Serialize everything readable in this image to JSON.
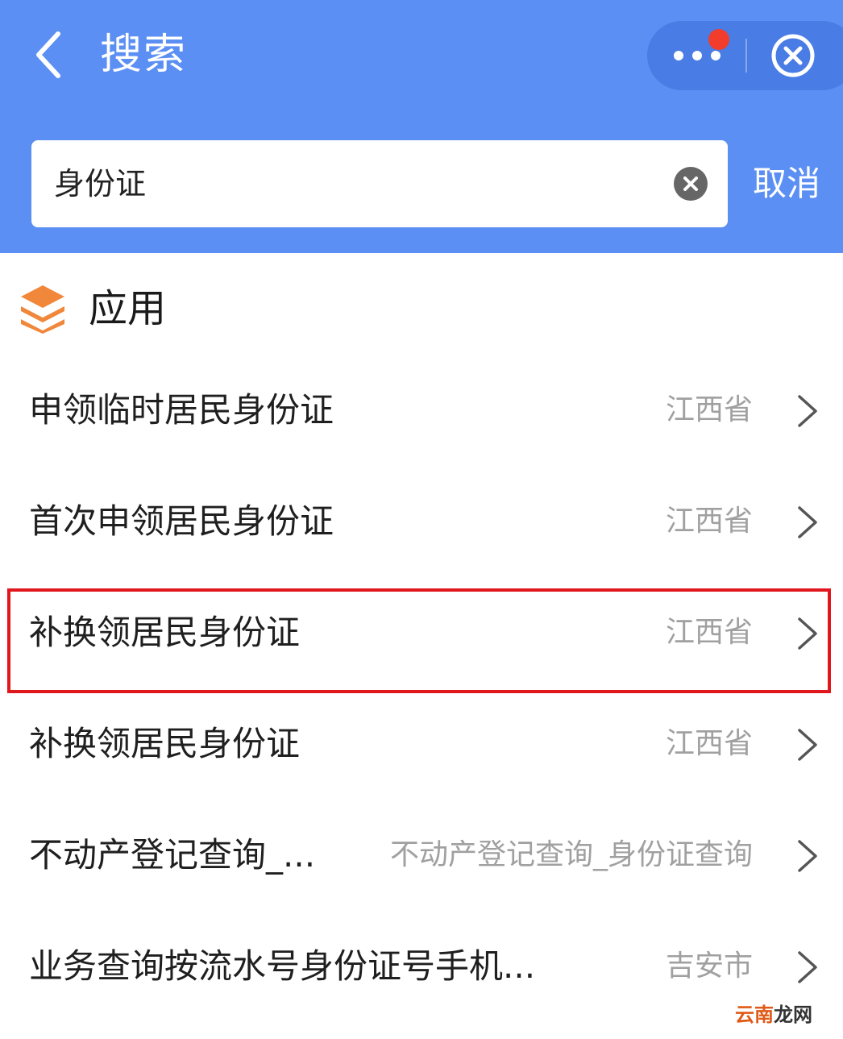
{
  "header": {
    "title": "搜索",
    "back_icon": "chevron-left-icon",
    "more_icon": "more-dots-icon",
    "close_icon": "close-circle-icon",
    "notification_color": "#f23c2c",
    "background_color": "#5b8ff3"
  },
  "search": {
    "value": "身份证",
    "clear_icon": "clear-circle-icon",
    "cancel_label": "取消"
  },
  "section": {
    "icon": "layers-icon",
    "title": "应用"
  },
  "results": [
    {
      "title": "申领临时居民身份证",
      "region": "江西省"
    },
    {
      "title": "首次申领居民身份证",
      "region": "江西省"
    },
    {
      "title": "补换领居民身份证",
      "region": "江西省",
      "highlighted": true
    },
    {
      "title": "补换领居民身份证",
      "region": "江西省"
    },
    {
      "title": "不动产登记查询_...",
      "region": "不动产登记查询_身份证查询"
    },
    {
      "title": "业务查询按流水号身份证号手机...",
      "region": "吉安市"
    }
  ],
  "highlight_color": "#e0171d",
  "watermark": {
    "part1": "云南",
    "part2": "龙网"
  }
}
